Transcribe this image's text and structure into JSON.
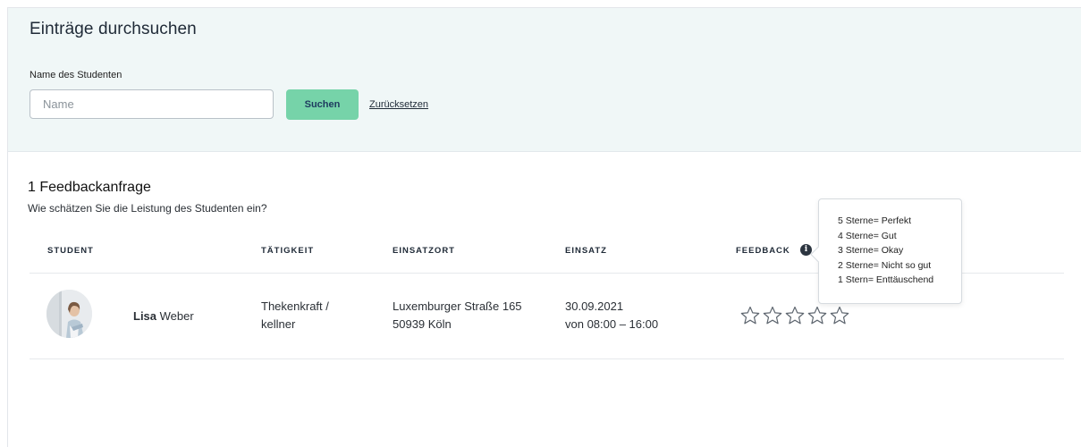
{
  "search": {
    "title": "Einträge durchsuchen",
    "field_label": "Name des Studenten",
    "placeholder": "Name",
    "value": "",
    "search_button": "Suchen",
    "reset_link": "Zurücksetzen"
  },
  "results": {
    "title": "1 Feedbackanfrage",
    "subtitle": "Wie schätzen Sie die Leistung des Studenten ein?",
    "columns": {
      "student": "STUDENT",
      "activity": "TÄTIGKEIT",
      "location": "EINSATZORT",
      "assignment": "EINSATZ",
      "feedback": "FEEDBACK"
    },
    "rows": [
      {
        "first_name": "Lisa",
        "last_name": "Weber",
        "activity_line1": "Thekenkraft /",
        "activity_line2": "kellner",
        "location_line1": "Luxemburger Straße 165",
        "location_line2": "50939 Köln",
        "date": "30.09.2021",
        "time": "von 08:00 – 16:00",
        "rating": 0,
        "max_rating": 5
      }
    ]
  },
  "tooltip": {
    "lines": [
      "5 Sterne= Perfekt",
      "4 Sterne= Gut",
      "3 Sterne= Okay",
      "2 Sterne= Nicht so gut",
      "1 Stern= Enttäuschend"
    ]
  },
  "icons": {
    "info": "info-icon",
    "star": "star-outline-icon"
  },
  "colors": {
    "panel_bg": "#f0f7f7",
    "button_bg": "#76d3a9",
    "button_text": "#1e3a5f",
    "star_outline": "#5f6770"
  }
}
